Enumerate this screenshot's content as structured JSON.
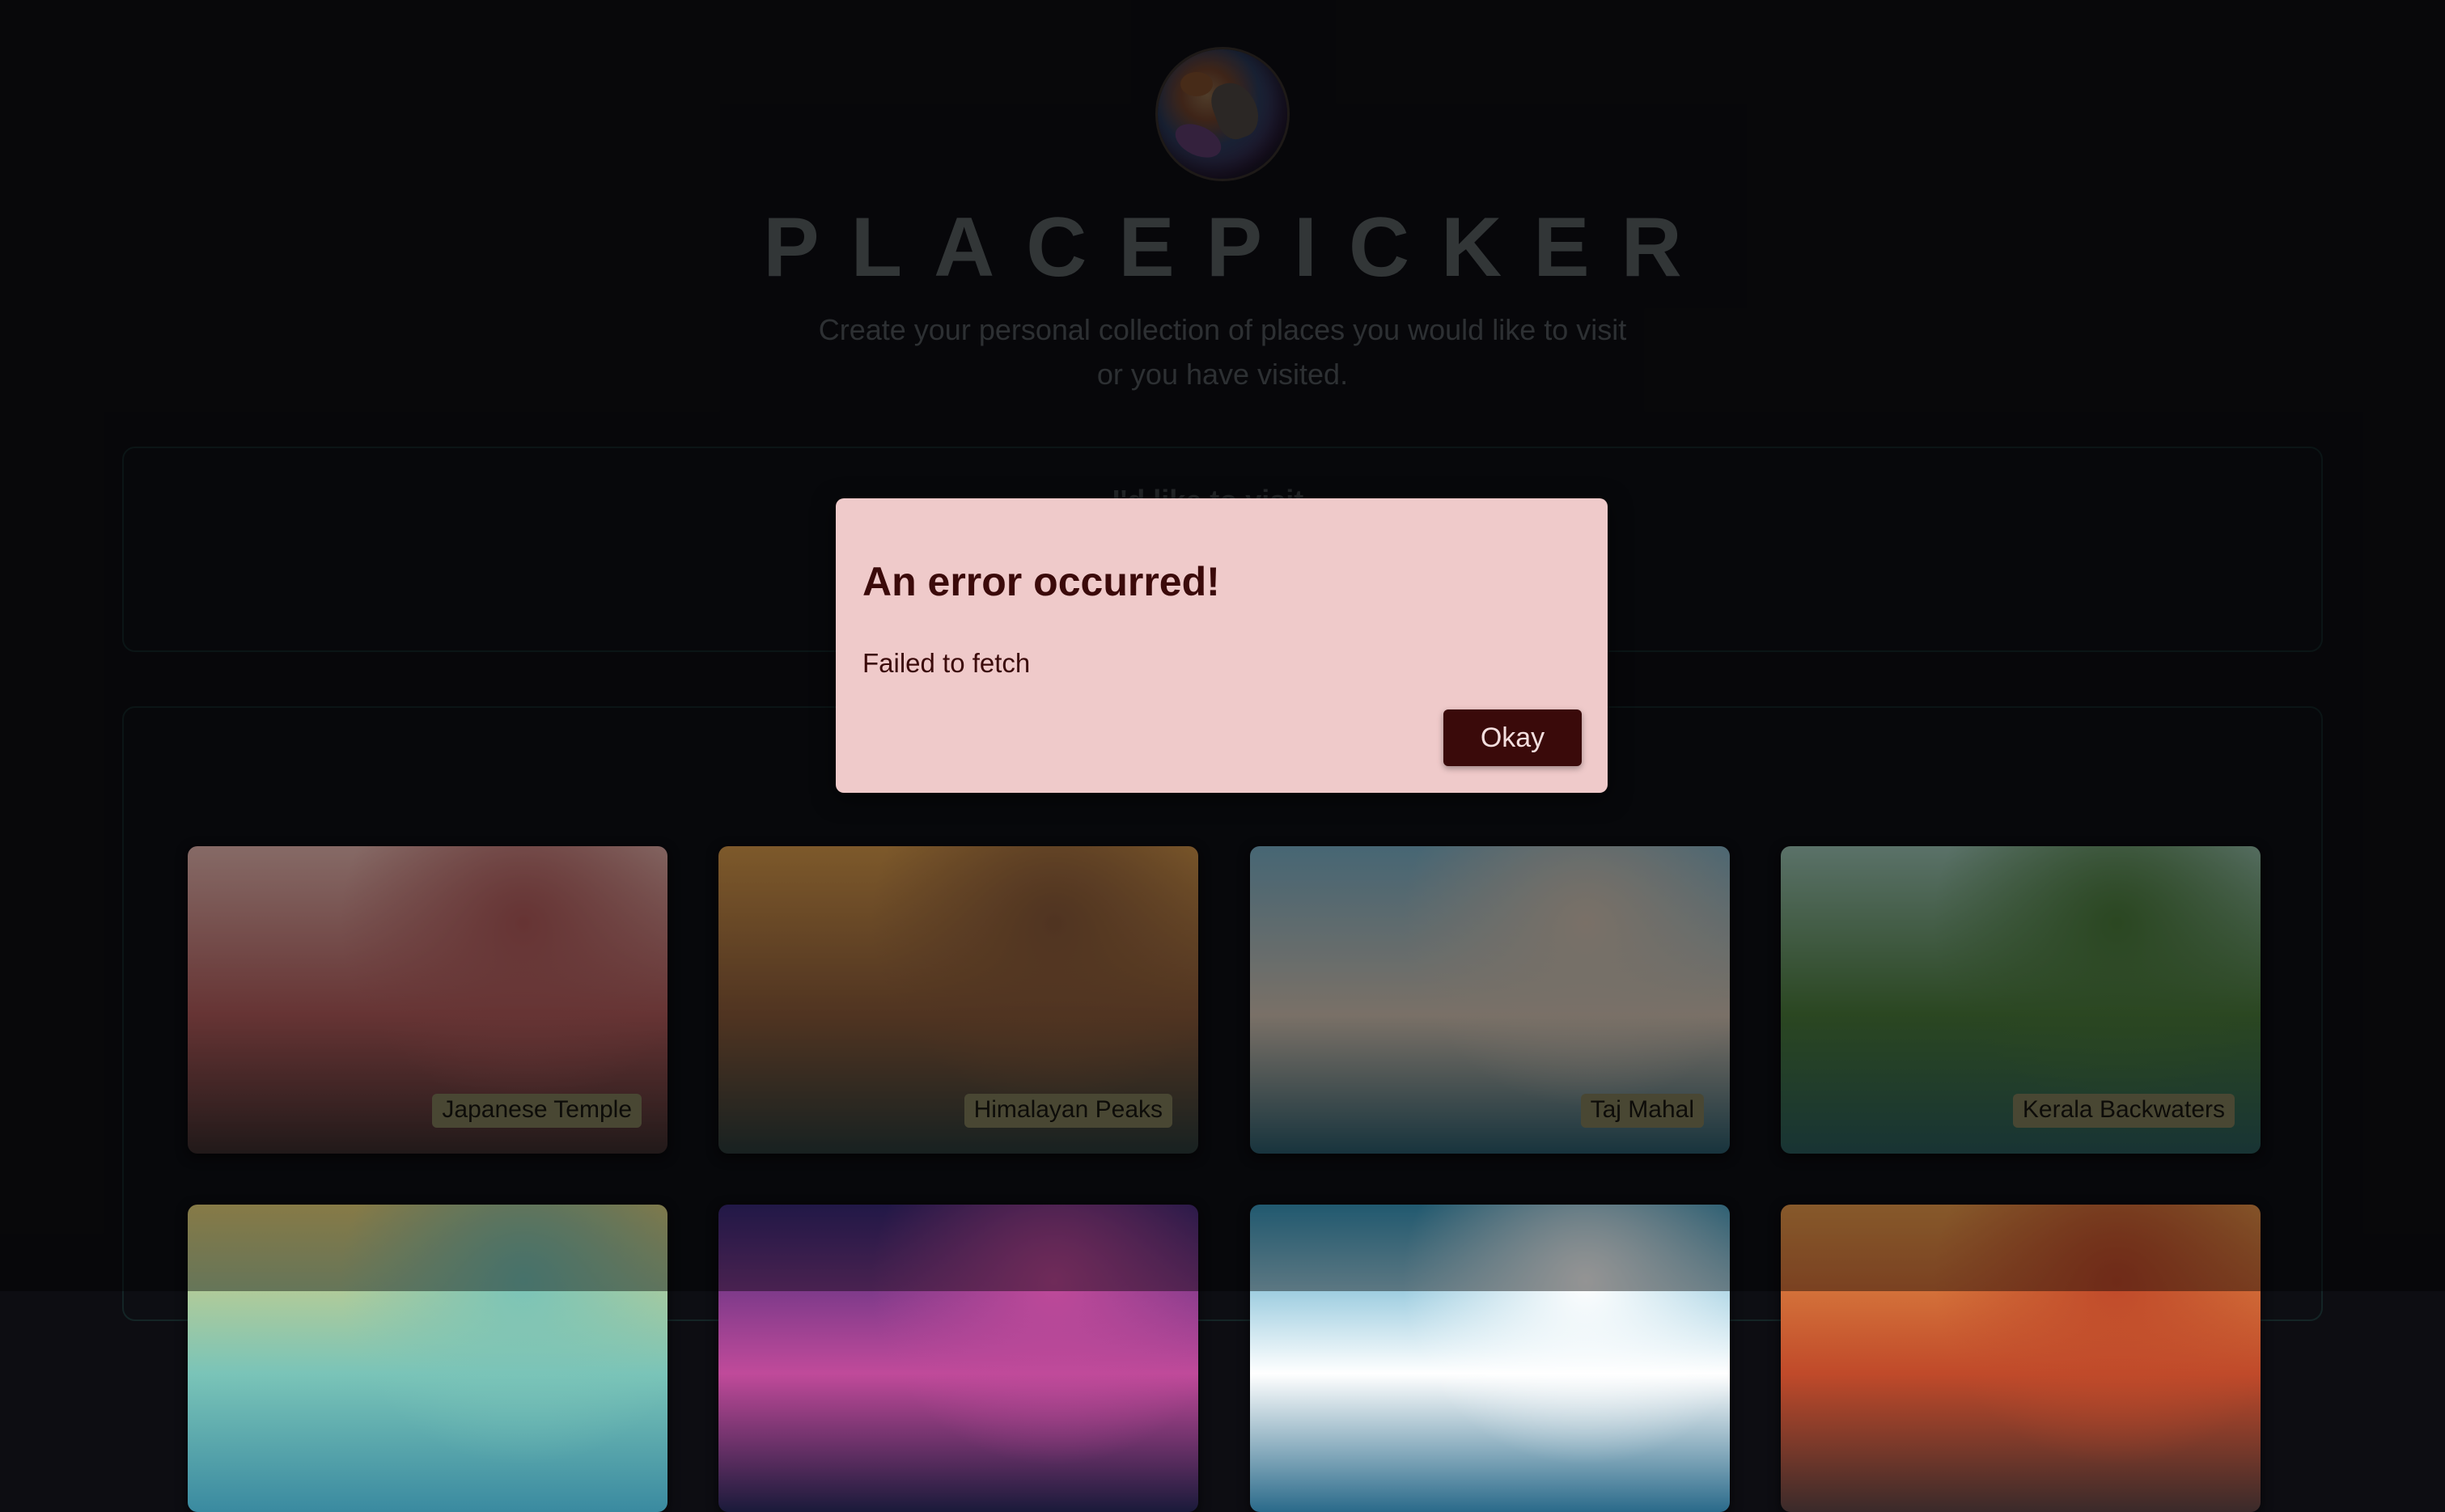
{
  "header": {
    "logo_icon": "globe-logo-icon",
    "title": "PLACEPICKER",
    "subtitle": "Create your personal collection of places you would like to visit or you have visited."
  },
  "sections": {
    "wishlist_heading": "I'd like to visit ..."
  },
  "places": [
    {
      "title": "Japanese Temple",
      "colors": [
        "#e7b7b0",
        "#b05a5a",
        "#3a2c2c"
      ]
    },
    {
      "title": "Himalayan Peaks",
      "colors": [
        "#d89a4a",
        "#8a5a3a",
        "#2a3a3a"
      ]
    },
    {
      "title": "Taj Mahal",
      "colors": [
        "#7ab0c8",
        "#d2c2b2",
        "#2a5a6a"
      ]
    },
    {
      "title": "Kerala Backwaters",
      "colors": [
        "#9cc4b4",
        "#4a7a3a",
        "#2a5a5a"
      ]
    },
    {
      "title": "",
      "colors": [
        "#e8d27a",
        "#7ac4b8",
        "#3a8aa0"
      ]
    },
    {
      "title": "",
      "colors": [
        "#3a2a7a",
        "#c04a9a",
        "#1a1a3a"
      ]
    },
    {
      "title": "",
      "colors": [
        "#3a9ac0",
        "#ffffff",
        "#2a6a8a"
      ]
    },
    {
      "title": "",
      "colors": [
        "#e89a4a",
        "#c04a2a",
        "#3a2a2a"
      ]
    }
  ],
  "modal": {
    "title": "An error occurred!",
    "message": "Failed to fetch",
    "button_label": "Okay"
  },
  "colors": {
    "background": "#0d0d12",
    "modal_background": "#efcaca",
    "modal_text": "#3b0a0a",
    "button_background": "#3a0a0a",
    "card_label_background": "#7f7b58"
  }
}
